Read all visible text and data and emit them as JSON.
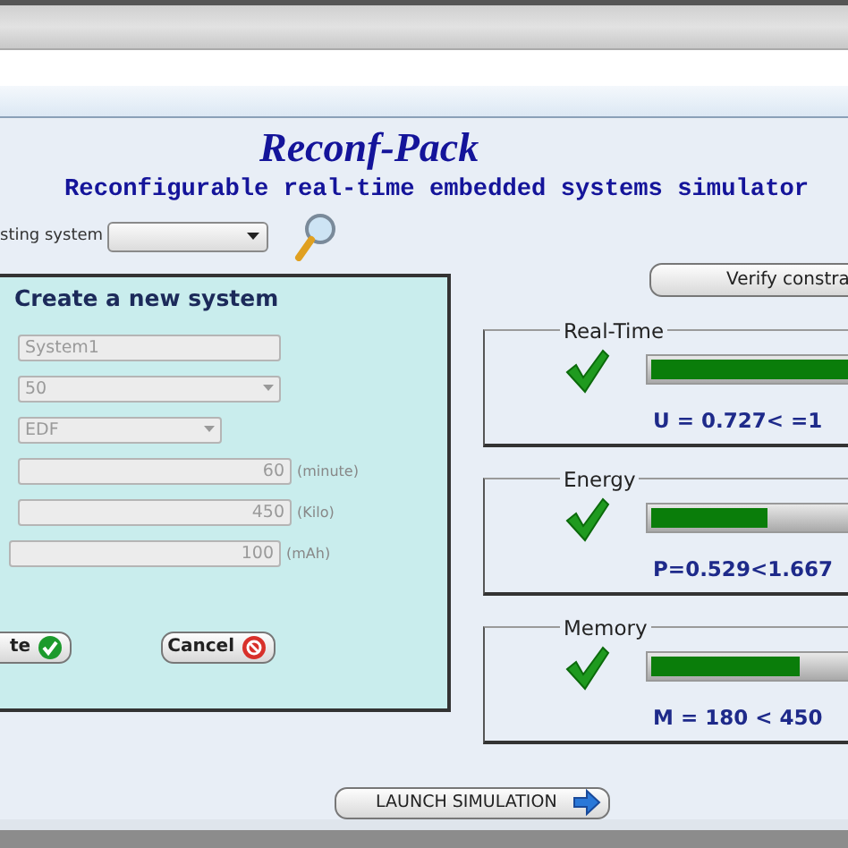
{
  "title": "Reconf-Pack",
  "subtitle": "Reconfigurable real-time embedded systems simulator",
  "existing_system": {
    "label": "sting system"
  },
  "verify_button": "Verify constra",
  "create_panel": {
    "title": "Create a new system",
    "fields": [
      {
        "kind": "text",
        "value": "System1",
        "disabled": true
      },
      {
        "kind": "select",
        "value": "50",
        "disabled": true
      },
      {
        "kind": "select",
        "value": "EDF",
        "disabled": true
      },
      {
        "kind": "number",
        "value": "60",
        "unit": "(minute)",
        "disabled": true
      },
      {
        "kind": "number",
        "value": "450",
        "unit": "(Kilo)",
        "disabled": true
      },
      {
        "kind": "number",
        "value": "100",
        "unit": "(mAh)",
        "disabled": true
      }
    ],
    "buttons": [
      {
        "kind": "ok",
        "label": "te"
      },
      {
        "kind": "cancel",
        "label": "Cancel"
      }
    ]
  },
  "constraints": [
    {
      "title": "Real-Time",
      "satisfied": true,
      "level": 1,
      "reading": "U = 0.727< =1"
    },
    {
      "title": "Energy",
      "satisfied": true,
      "level": 0.55,
      "reading": "P=0.529<1.667"
    },
    {
      "title": "Memory",
      "satisfied": true,
      "level": 0.7,
      "reading": "M = 180 < 450"
    }
  ],
  "launch_button": "LAUNCH SIMULATION"
}
